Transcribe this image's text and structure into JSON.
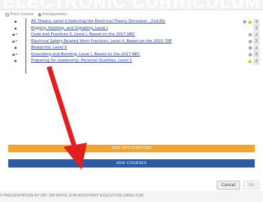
{
  "banner": {
    "title": "ELECTRONIC CURRICULUM ADVANCED"
  },
  "legend": {
    "print_course": "Print Course",
    "prerequisites": "Prerequisites"
  },
  "courses": [
    {
      "title": "AC Theory, Level II featuring the Electrical Theory Simulator - 2nd Ed.",
      "hours": "3",
      "flags": [
        "gray",
        "warn"
      ]
    },
    {
      "title": "Rigging, Hoisting, and Signaling, Level I",
      "hours": "2",
      "flags": []
    },
    {
      "title": "Code and Practices 3, Level I, Based on the 2017 NEC",
      "hours": "2",
      "flags": [
        "gray"
      ]
    },
    {
      "title": "Electrical Safety-Related Work Practices, Level II, Based on the 2015 70E",
      "hours": "2",
      "flags": [
        "gray"
      ]
    },
    {
      "title": "Blueprints, Level II",
      "hours": "2",
      "flags": [
        "gray"
      ]
    },
    {
      "title": "Grounding and Bonding, Level I, Based on the 2017 NEC",
      "hours": "2",
      "flags": [
        "gray"
      ]
    },
    {
      "title": "Preparing for Leadership: Personal Qualities, Level 1",
      "hours": "2",
      "flags": [
        "warn"
      ]
    }
  ],
  "actions": {
    "add_applications": "ADD APPLICATIONS",
    "add_courses": "ADD COURSES",
    "cancel": "Cancel",
    "ok": "OK"
  },
  "footer": {
    "credit": "Y PRESENTATION BY DR. JIM BOYD, ETA ASSISTANT EXECUTIVE DIRECTOR"
  },
  "colors": {
    "link_blue": "#1f3f8f",
    "button_orange": "#f2a431",
    "button_blue": "#2c5aa0",
    "annotation_red": "#e02020"
  }
}
